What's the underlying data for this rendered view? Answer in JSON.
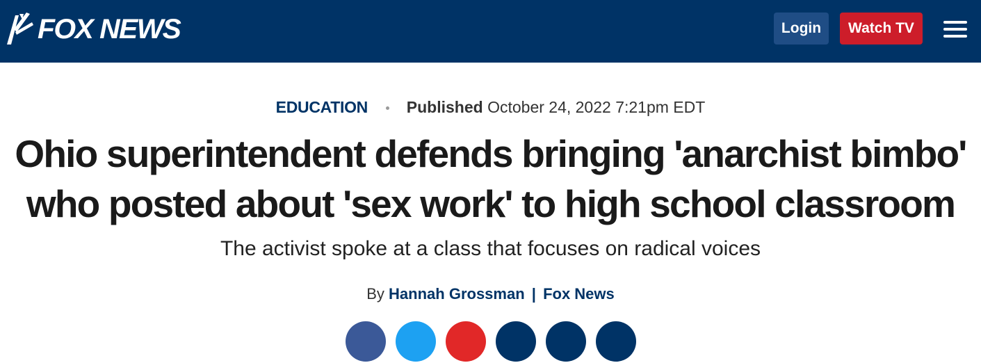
{
  "header": {
    "logo_text": "FOX NEWS",
    "login_label": "Login",
    "watch_label": "Watch TV",
    "colors": {
      "background": "#003366",
      "login": "#1f4d85",
      "watch": "#cd1d2a"
    }
  },
  "article": {
    "category": "EDUCATION",
    "published_label": "Published",
    "published_date": "October 24, 2022 7:21pm EDT",
    "headline": "Ohio superintendent defends bringing 'anarchist bimbo' who posted about 'sex work' to high school classroom",
    "subheadline": "The activist spoke at a class that focuses on radical voices",
    "byline_prefix": "By",
    "author": "Hannah Grossman",
    "byline_separator": "|",
    "source": "Fox News"
  },
  "share": {
    "icons": [
      "facebook-icon",
      "twitter-icon",
      "flipboard-icon",
      "comments-icon",
      "print-icon",
      "email-icon"
    ],
    "colors": [
      "#3b5998",
      "#1da1f2",
      "#e12828",
      "#003366",
      "#003366",
      "#003366"
    ]
  }
}
